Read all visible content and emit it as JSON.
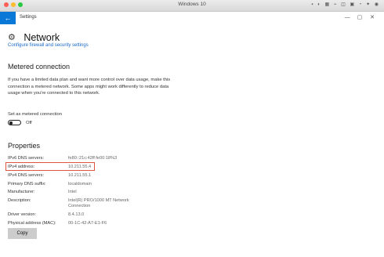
{
  "host": {
    "title": "Windows 10",
    "status_icons": "▪ ◐ ▦ ⌁ ◫ ▣ ◔ ✦ ◉"
  },
  "window": {
    "title": "Settings",
    "back_icon": "←",
    "minimize": "—",
    "maximize": "▢",
    "close": "✕"
  },
  "page": {
    "title": "Network",
    "gear_icon": "⚙",
    "link": "Configure firewall and security settings"
  },
  "metered": {
    "title": "Metered connection",
    "description": "If you have a limited data plan and want more control over data usage, make this connection a metered network. Some apps might work differently to reduce data usage when you're connected to this network.",
    "toggle_label": "Set as metered connection",
    "toggle_state": "Off"
  },
  "properties": {
    "title": "Properties",
    "rows": [
      {
        "label": "IPv6 DNS servers:",
        "value": "fe80::21c:42ff:fe00:18%3"
      },
      {
        "label": "IPv4 address:",
        "value": "10.211.55.4"
      },
      {
        "label": "IPv4 DNS servers:",
        "value": "10.211.55.1"
      },
      {
        "label": "Primary DNS suffix:",
        "value": "localdomain"
      },
      {
        "label": "Manufacturer:",
        "value": "Intel"
      },
      {
        "label": "Description:",
        "value": "Intel(R) PRO/1000 MT Network Connection"
      },
      {
        "label": "Driver version:",
        "value": "8.4.13.0"
      },
      {
        "label": "Physical address (MAC):",
        "value": "00-1C-42-A7-E1-F6"
      }
    ],
    "copy_button": "Copy"
  },
  "colors": {
    "accent": "#0a78d7",
    "link": "#1a68c4",
    "highlight_border": "#e0543f"
  }
}
